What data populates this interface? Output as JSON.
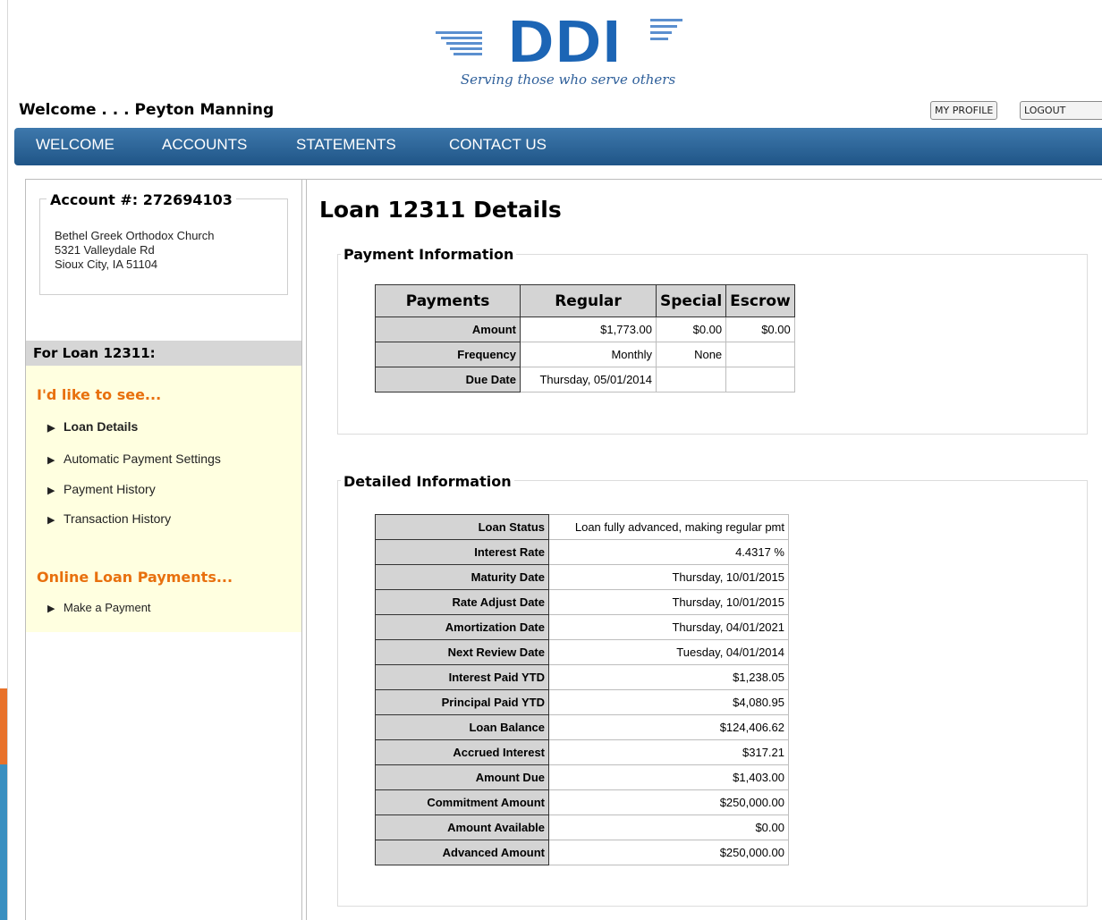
{
  "header": {
    "logo_text": "DDI",
    "tagline": "Serving those who serve others",
    "welcome_text": "Welcome . . . Peyton Manning",
    "my_profile_label": "MY PROFILE",
    "logout_label": "LOGOUT"
  },
  "nav": {
    "items": [
      "WELCOME",
      "ACCOUNTS",
      "STATEMENTS",
      "CONTACT US"
    ]
  },
  "sidebar": {
    "account_label": "Account #:  272694103",
    "address": [
      "Bethel Greek Orthodox Church",
      "5321 Valleydale Rd",
      "Sioux City, IA 51104"
    ],
    "loan_header": "For Loan 12311:",
    "see_title": "I'd like to see...",
    "see_links": [
      "Loan Details",
      "Automatic Payment Settings",
      "Payment History",
      "Transaction History"
    ],
    "payments_title": "Online Loan Payments...",
    "payment_links": [
      "Make a Payment"
    ]
  },
  "main": {
    "title": "Loan 12311 Details",
    "payment_info": {
      "legend": "Payment Information",
      "columns": [
        "Payments",
        "Regular",
        "Special",
        "Escrow"
      ],
      "rows": [
        {
          "label": "Amount",
          "regular": "$1,773.00",
          "special": "$0.00",
          "escrow": "$0.00"
        },
        {
          "label": "Frequency",
          "regular": "Monthly",
          "special": "None",
          "escrow": ""
        },
        {
          "label": "Due Date",
          "regular": "Thursday, 05/01/2014",
          "special": "",
          "escrow": ""
        }
      ]
    },
    "detailed_info": {
      "legend": "Detailed Information",
      "rows": [
        {
          "label": "Loan Status",
          "value": "Loan fully advanced, making regular pmt"
        },
        {
          "label": "Interest Rate",
          "value": "4.4317 %"
        },
        {
          "label": "Maturity Date",
          "value": "Thursday, 10/01/2015"
        },
        {
          "label": "Rate Adjust Date",
          "value": "Thursday, 10/01/2015"
        },
        {
          "label": "Amortization Date",
          "value": "Thursday, 04/01/2021"
        },
        {
          "label": "Next Review Date",
          "value": "Tuesday, 04/01/2014"
        },
        {
          "label": "Interest Paid YTD",
          "value": "$1,238.05"
        },
        {
          "label": "Principal Paid YTD",
          "value": "$4,080.95"
        },
        {
          "label": "Loan Balance",
          "value": "$124,406.62"
        },
        {
          "label": "Accrued Interest",
          "value": "$317.21"
        },
        {
          "label": "Amount Due",
          "value": "$1,403.00"
        },
        {
          "label": "Commitment Amount",
          "value": "$250,000.00"
        },
        {
          "label": "Amount Available",
          "value": "$0.00"
        },
        {
          "label": "Advanced Amount",
          "value": "$250,000.00"
        }
      ]
    }
  },
  "colors": {
    "nav_bg": "#2a64a0",
    "accent_orange": "#e8700e",
    "sidebar_panel": "#ffffe0",
    "logo_blue": "#1c65b5"
  }
}
